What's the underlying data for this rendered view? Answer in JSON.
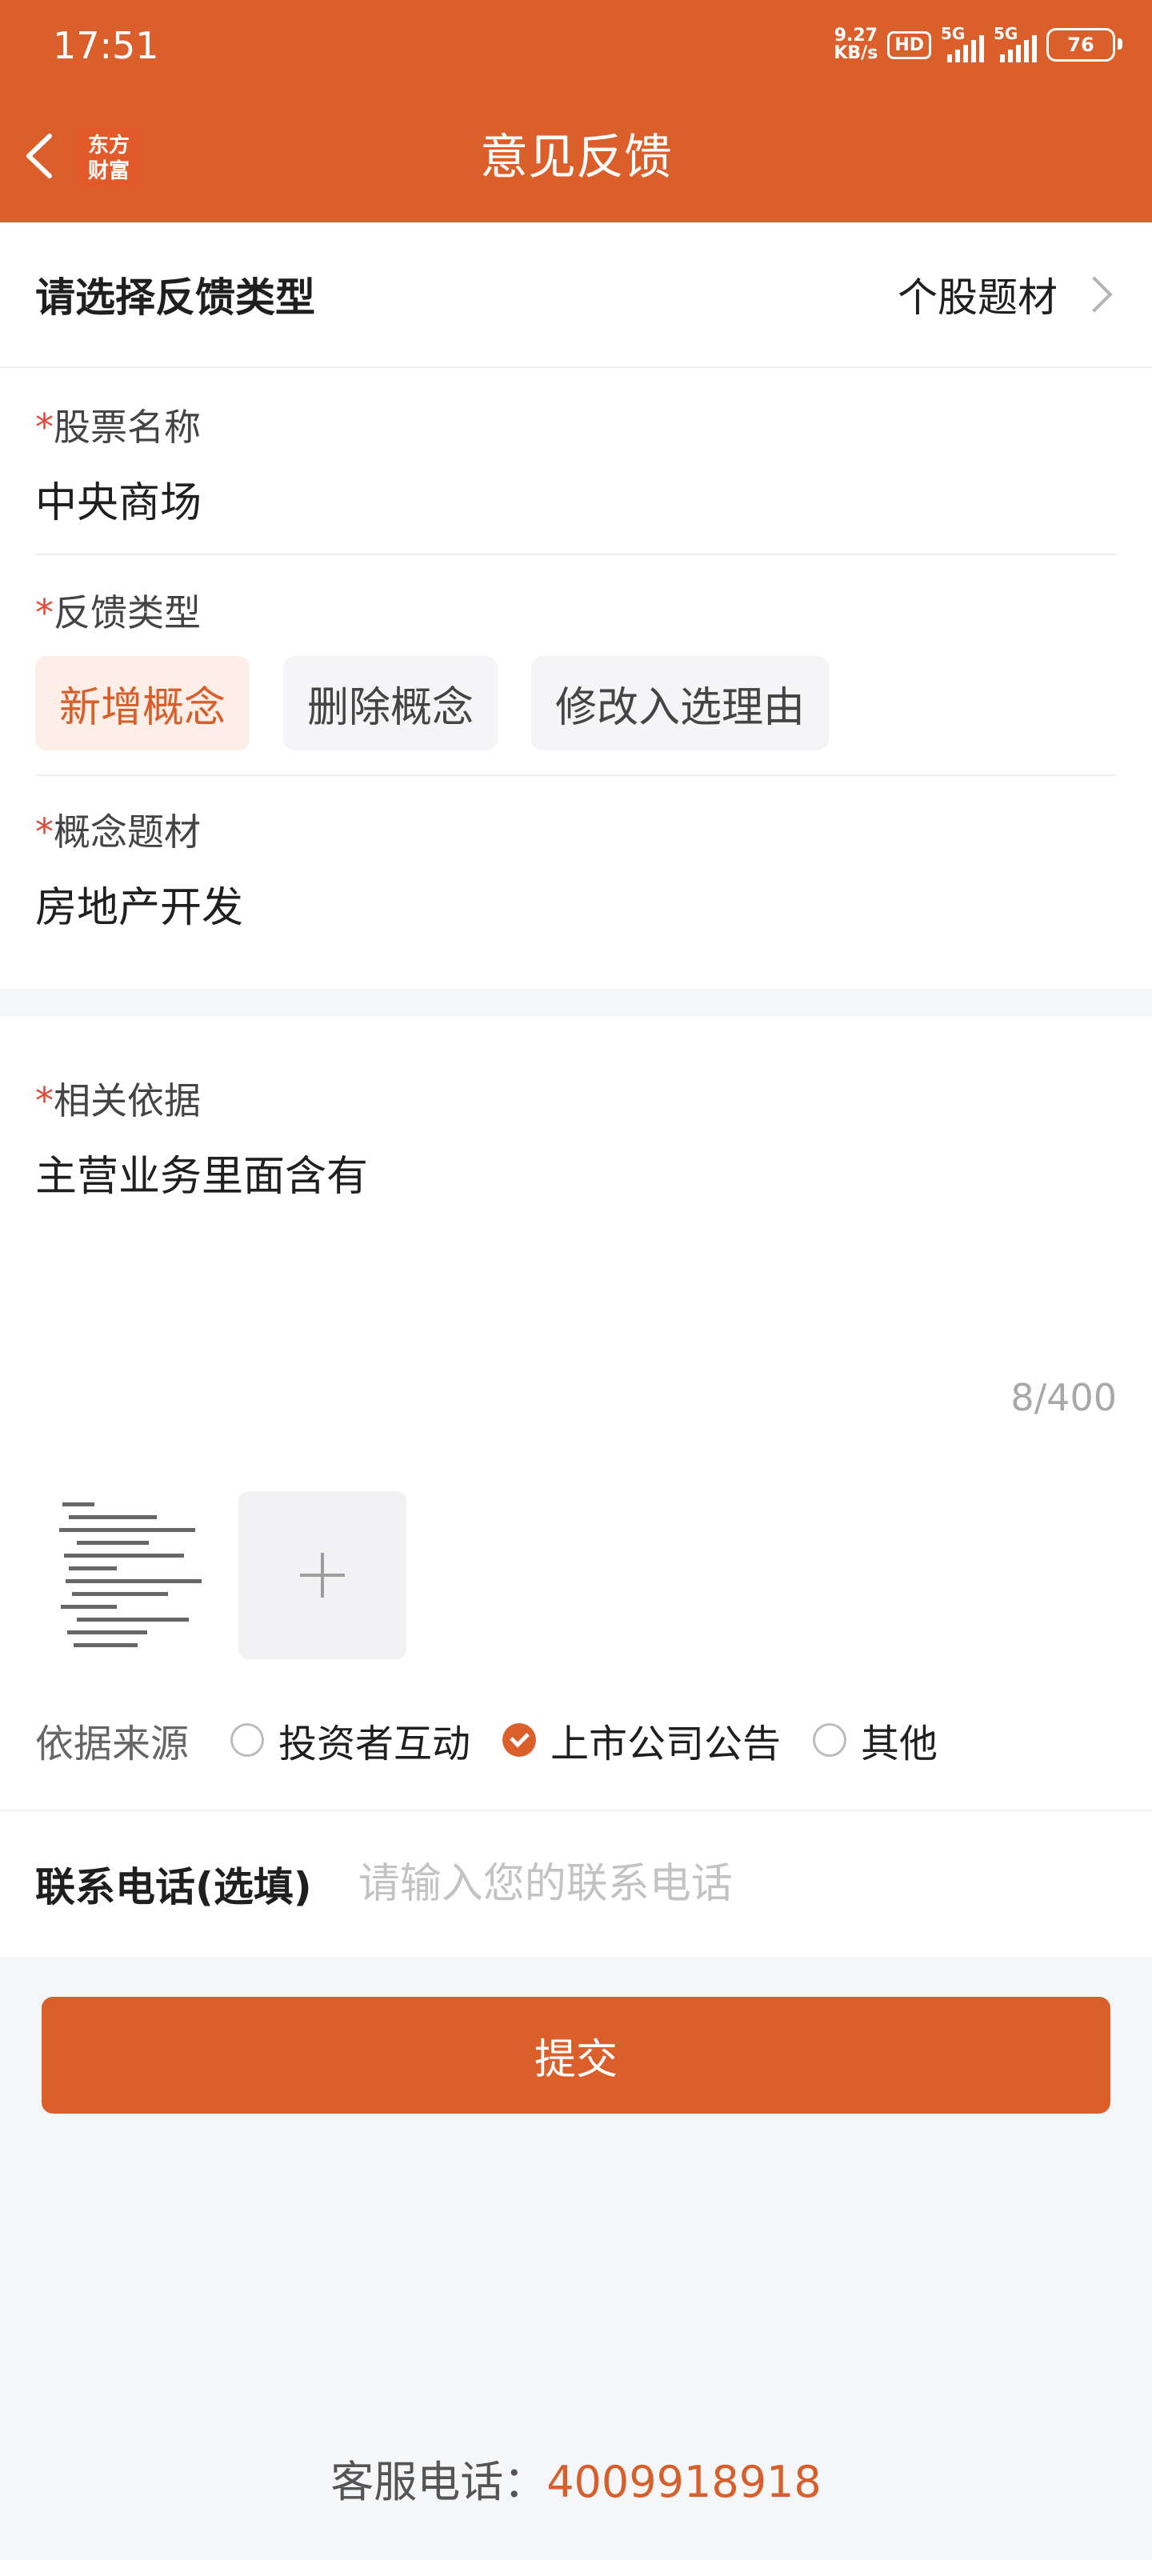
{
  "status_bar": {
    "time": "17:51",
    "speed_value": "9.27",
    "speed_unit": "KB/s",
    "hd": "HD",
    "sig1": "5G",
    "sig2": "5G",
    "battery": "76"
  },
  "nav": {
    "logo_line1": "东方",
    "logo_line2": "财富",
    "title": "意见反馈"
  },
  "type_select": {
    "label": "请选择反馈类型",
    "value": "个股题材"
  },
  "stock": {
    "label": "股票名称",
    "value": "中央商场"
  },
  "feedback_type": {
    "label": "反馈类型",
    "options": [
      "新增概念",
      "删除概念",
      "修改入选理由"
    ],
    "selected": 0
  },
  "concept": {
    "label": "概念题材",
    "value": "房地产开发"
  },
  "basis": {
    "label": "相关依据",
    "value": "主营业务里面含有",
    "count": "8/400"
  },
  "source": {
    "label": "依据来源",
    "options": [
      "投资者互动",
      "上市公司公告",
      "其他"
    ],
    "selected": 1
  },
  "contact": {
    "label": "联系电话(选填)",
    "placeholder": "请输入您的联系电话"
  },
  "submit": {
    "label": "提交"
  },
  "footer": {
    "label": "客服电话：",
    "phone": "4009918918"
  },
  "colors": {
    "brand": "#db5f2b",
    "required_star": "#e04a3a",
    "chip_active_bg": "#fdeee7"
  }
}
